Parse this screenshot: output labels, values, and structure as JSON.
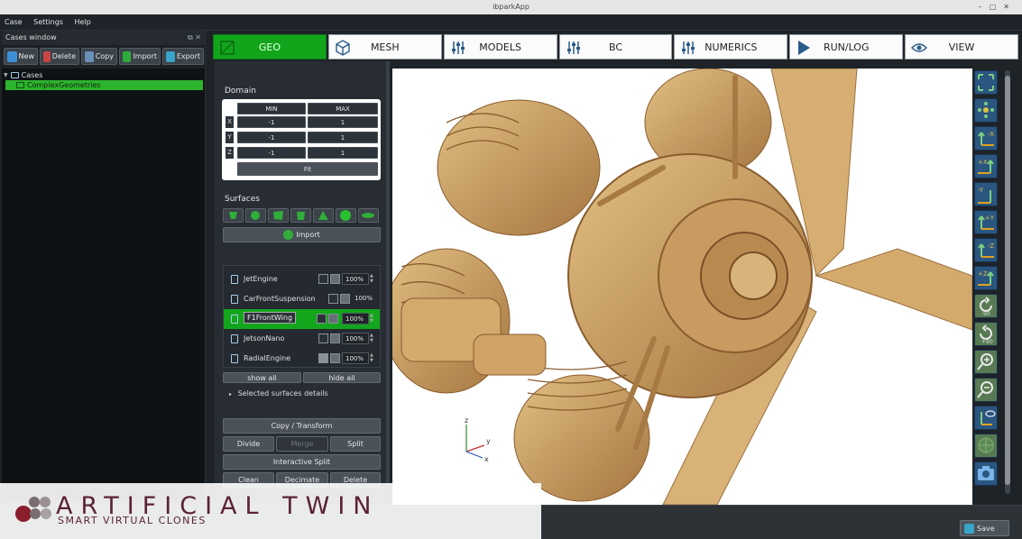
{
  "window": {
    "title": "ibparkApp"
  },
  "menu": [
    "Case",
    "Settings",
    "Help"
  ],
  "cases": {
    "title": "Cases window",
    "toolbar": [
      "New",
      "Delete",
      "Copy",
      "Import",
      "Export"
    ],
    "tree": {
      "root": "Cases",
      "child": "ComplexGeometries"
    }
  },
  "tabs": [
    "GEO",
    "MESH",
    "MODELS",
    "BC",
    "NUMERICS",
    "RUN/LOG",
    "VIEW"
  ],
  "domain": {
    "title": "Domain",
    "min_label": "MIN",
    "max_label": "MAX",
    "rows": [
      {
        "axis": "X",
        "min": "-1",
        "max": "1"
      },
      {
        "axis": "Y",
        "min": "-1",
        "max": "1"
      },
      {
        "axis": "Z",
        "min": "-1",
        "max": "1"
      }
    ],
    "fit": "Fit"
  },
  "surfaces": {
    "title": "Surfaces",
    "import": "Import",
    "items": [
      {
        "name": "JetEngine",
        "pct": "100%"
      },
      {
        "name": "CarFrontSuspension",
        "pct": "100%"
      },
      {
        "name": "F1FrontWing",
        "pct": "100%"
      },
      {
        "name": "JetsonNano",
        "pct": "100%"
      },
      {
        "name": "RadialEngine",
        "pct": "100%"
      }
    ],
    "show_all": "show all",
    "hide_all": "hide all",
    "details": "Selected surfaces details"
  },
  "ops": {
    "copy_transform": "Copy / Transform",
    "divide": "Divide",
    "merge": "Merge",
    "split": "Split",
    "interactive_split": "Interactive Split",
    "clean": "Clean",
    "decimate": "Decimate",
    "delete": "Delete"
  },
  "view_tools": [
    "-X",
    "+X",
    "-Y",
    "+Y",
    "-Z",
    "+Z",
    "-90",
    "+90"
  ],
  "axes": {
    "x": "x",
    "y": "y",
    "z": "z"
  },
  "footer": {
    "save": "Save"
  },
  "logo": {
    "name": "ARTIFICIAL TWIN",
    "tagline": "SMART VIRTUAL CLONES"
  }
}
